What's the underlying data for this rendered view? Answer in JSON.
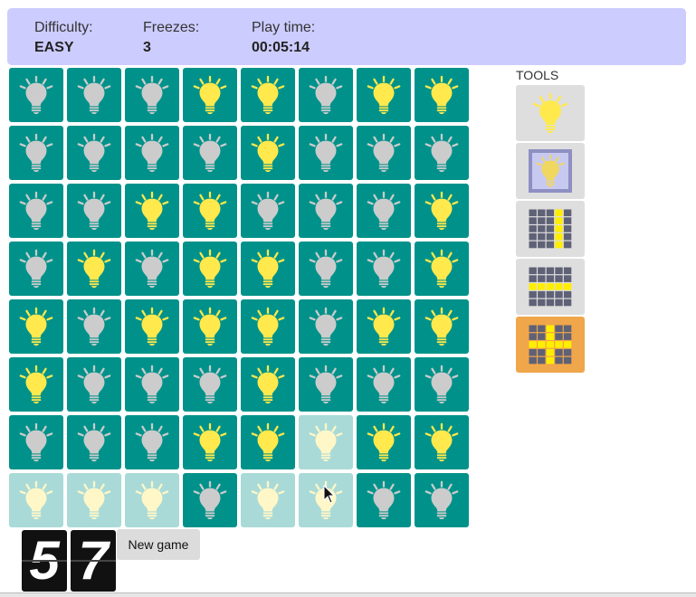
{
  "header": {
    "difficulty_label": "Difficulty:",
    "difficulty_value": "EASY",
    "freezes_label": "Freezes:",
    "freezes_value": "3",
    "playtime_label": "Play time:",
    "playtime_value": "00:05:14"
  },
  "board": {
    "rows": 8,
    "cols": 8,
    "legend": {
      "y": "lit bulb on teal",
      "g": "unlit bulb on teal",
      "l": "lit bulb faded (pale cell)",
      "d": "unlit bulb faded (pale cell)"
    },
    "cells": [
      [
        "g",
        "g",
        "g",
        "y",
        "y",
        "g",
        "y",
        "y"
      ],
      [
        "g",
        "g",
        "g",
        "g",
        "y",
        "g",
        "g",
        "g"
      ],
      [
        "g",
        "g",
        "y",
        "y",
        "g",
        "g",
        "g",
        "y"
      ],
      [
        "g",
        "y",
        "g",
        "y",
        "y",
        "g",
        "g",
        "y"
      ],
      [
        "y",
        "g",
        "y",
        "y",
        "y",
        "g",
        "y",
        "y"
      ],
      [
        "y",
        "g",
        "g",
        "g",
        "y",
        "g",
        "g",
        "g"
      ],
      [
        "g",
        "g",
        "g",
        "y",
        "y",
        "l",
        "y",
        "y"
      ],
      [
        "l",
        "l",
        "l",
        "g",
        "l",
        "l",
        "g",
        "g"
      ]
    ]
  },
  "tools": {
    "label": "TOOLS",
    "items": [
      {
        "name": "single-bulb-tool",
        "icon": "bulb-icon"
      },
      {
        "name": "framed-bulb-tool",
        "icon": "framed-bulb-icon"
      },
      {
        "name": "column-tool",
        "icon": "column-grid-icon"
      },
      {
        "name": "row-tool",
        "icon": "row-grid-icon"
      },
      {
        "name": "cross-tool",
        "icon": "cross-grid-icon",
        "active": true
      }
    ]
  },
  "counter": {
    "digit1": "5",
    "digit2": "7"
  },
  "new_game_label": "New game",
  "colors": {
    "header_bg": "#ccccff",
    "cell_teal": "#00928a",
    "cell_pale": "#a9dad7",
    "bulb_lit": "#ffe94d",
    "bulb_unlit": "#cccccc",
    "bulb_faded": "#fff7c8",
    "tool_bg": "#dedede",
    "tool_active": "#f0a64a",
    "grid_dark": "#5f6176",
    "grid_lit": "#ffee00"
  }
}
